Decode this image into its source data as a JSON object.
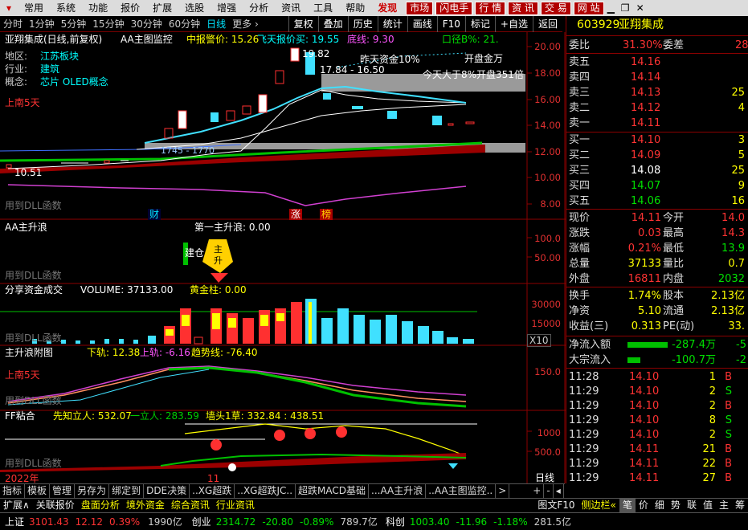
{
  "menu": {
    "items": [
      "常用",
      "系统",
      "功能",
      "报价",
      "扩展",
      "选股",
      "增强",
      "分析",
      "资讯",
      "工具",
      "帮助"
    ],
    "discover": "发现",
    "market": "市场",
    "flash": "闪电手",
    "quote": "行 情",
    "news": "资 讯",
    "trade": "交 易",
    "site": "网 站"
  },
  "periods": [
    "分时",
    "1分钟",
    "5分钟",
    "15分钟",
    "30分钟",
    "60分钟",
    "日线",
    "更多 ›"
  ],
  "tools": [
    "复权",
    "叠加",
    "历史",
    "统计",
    "画线",
    "F10",
    "标记",
    "+自选",
    "返回"
  ],
  "main": {
    "name": "亚翔集成(日线,前复权)",
    "indicator": "AA主图监控",
    "warn": "中报警价: 15.26",
    "flying": "飞天报价买: 19.55",
    "bottom": "底线: 9.30",
    "caliber": "口径B%: 21.",
    "region_label": "地区:",
    "region": "江苏板块",
    "industry_label": "行业:",
    "industry": "建筑",
    "concept_label": "概念:",
    "concept": "芯片 OLED概念",
    "high": "19.82",
    "range": "17.84 - 16.50",
    "yesterday": "昨天资金10%",
    "today": "今天大于8%开盘351倍",
    "open": "开盘金万",
    "low": "10.51",
    "mid": "1745 - 1770",
    "shang": "上南5天",
    "dll": "用到DLL函数",
    "tag_cai": "财",
    "tag_zhang": "涨",
    "tag_bang": "榜",
    "axis": [
      "20.00",
      "18.00",
      "16.00",
      "14.00",
      "12.00",
      "10.00",
      "8.00"
    ]
  },
  "p2": {
    "title": "AA主升浪",
    "sub": "第一主升浪: 0.00",
    "jiancang": "建仓",
    "zhucang": "主",
    "zhu2": "升",
    "axis": [
      "100.0",
      "50.00"
    ],
    "dll": "用到DLL函数"
  },
  "p3": {
    "title": "分享资金成交",
    "vol": "VOLUME: 37133.00",
    "gold": "黄金柱: 0.00",
    "axis": [
      "30000",
      "15000"
    ],
    "x10": "X10",
    "dll": "用到DLL函数"
  },
  "p4": {
    "title": "主升浪附图",
    "lower": "下轨: 12.38",
    "upper": "上轨: -6.16",
    "trend": "趋势线: -76.40",
    "axis": [
      "150.0"
    ],
    "shang": "上南5天",
    "dll": "用到DLL函数"
  },
  "p5": {
    "title": "FF粘合",
    "a": "先知立人: 532.07",
    "b": "一立人: 283.59",
    "c": "墙头1草: 332.84 : 438.51",
    "axis": [
      "1000",
      "500.0"
    ],
    "dll": "用到DLL函数",
    "year": "2022年",
    "month": "11",
    "period": "日线"
  },
  "tabs": [
    "指标",
    "模板",
    "管理",
    "另存为",
    "绑定到",
    "DDE决策",
    "..XG超跌",
    "..XG超跌JC..",
    "超跌MACD基础",
    "...AA主升浪",
    "..AA主图监控..",
    ">"
  ],
  "bottombar": [
    "扩展∧",
    "关联报价",
    "盘面分析",
    "境外资金",
    "综合资讯",
    "行业资讯"
  ],
  "bottom_right": [
    "图文F10",
    "侧边栏«",
    "笔",
    "价",
    "细",
    "势",
    "联",
    "值",
    "主",
    "筹"
  ],
  "stock": {
    "code": "603929",
    "name": "亚翔集成",
    "weibi_label": "委比",
    "weibi": "31.30%",
    "weicha_label": "委差",
    "weicha": "28",
    "asks": [
      {
        "l": "卖五",
        "p": "14.16",
        "v": ""
      },
      {
        "l": "卖四",
        "p": "14.14",
        "v": ""
      },
      {
        "l": "卖三",
        "p": "14.13",
        "v": "25"
      },
      {
        "l": "卖二",
        "p": "14.12",
        "v": "4"
      },
      {
        "l": "卖一",
        "p": "14.11",
        "v": ""
      }
    ],
    "bids": [
      {
        "l": "买一",
        "p": "14.10",
        "v": "3"
      },
      {
        "l": "买二",
        "p": "14.09",
        "v": "5"
      },
      {
        "l": "买三",
        "p": "14.08",
        "v": "25"
      },
      {
        "l": "买四",
        "p": "14.07",
        "v": "9"
      },
      {
        "l": "买五",
        "p": "14.06",
        "v": "16"
      }
    ],
    "stats": [
      [
        "现价",
        "14.11",
        "今开",
        "14.0"
      ],
      [
        "涨跌",
        "0.03",
        "最高",
        "14.3"
      ],
      [
        "涨幅",
        "0.21%",
        "最低",
        "13.9"
      ],
      [
        "总量",
        "37133",
        "量比",
        "0.7"
      ],
      [
        "外盘",
        "16811",
        "内盘",
        "2032"
      ]
    ],
    "stats2": [
      [
        "换手",
        "1.74%",
        "股本",
        "2.13亿"
      ],
      [
        "净资",
        "5.10",
        "流通",
        "2.13亿"
      ],
      [
        "收益(三)",
        "0.313",
        "PE(动)",
        "33."
      ]
    ],
    "flow": [
      [
        "净流入额",
        "-287.4万",
        "-5"
      ],
      [
        "大宗流入",
        "-100.7万",
        "-2"
      ]
    ],
    "ticks": [
      [
        "11:28",
        "14.10",
        "1",
        "B"
      ],
      [
        "11:29",
        "14.10",
        "2",
        "S"
      ],
      [
        "11:29",
        "14.10",
        "2",
        "B"
      ],
      [
        "11:29",
        "14.10",
        "8",
        "S"
      ],
      [
        "11:29",
        "14.10",
        "2",
        "S"
      ],
      [
        "11:29",
        "14.11",
        "21",
        "B"
      ],
      [
        "11:29",
        "14.11",
        "22",
        "B"
      ],
      [
        "11:29",
        "14.11",
        "27",
        "B"
      ]
    ]
  },
  "status": {
    "sh_label": "上证",
    "sh": "3101.43",
    "sh_chg": "12.12",
    "sh_pct": "0.39%",
    "sh_amt": "1990亿",
    "cy_label": "创业",
    "cy": "2314.72",
    "cy_chg": "-20.80",
    "cy_pct": "-0.89%",
    "cy_amt": "789.7亿",
    "kc_label": "科创",
    "kc": "1003.40",
    "kc_chg": "-11.96",
    "kc_pct": "-1.18%",
    "kc_amt": "281.5亿"
  }
}
